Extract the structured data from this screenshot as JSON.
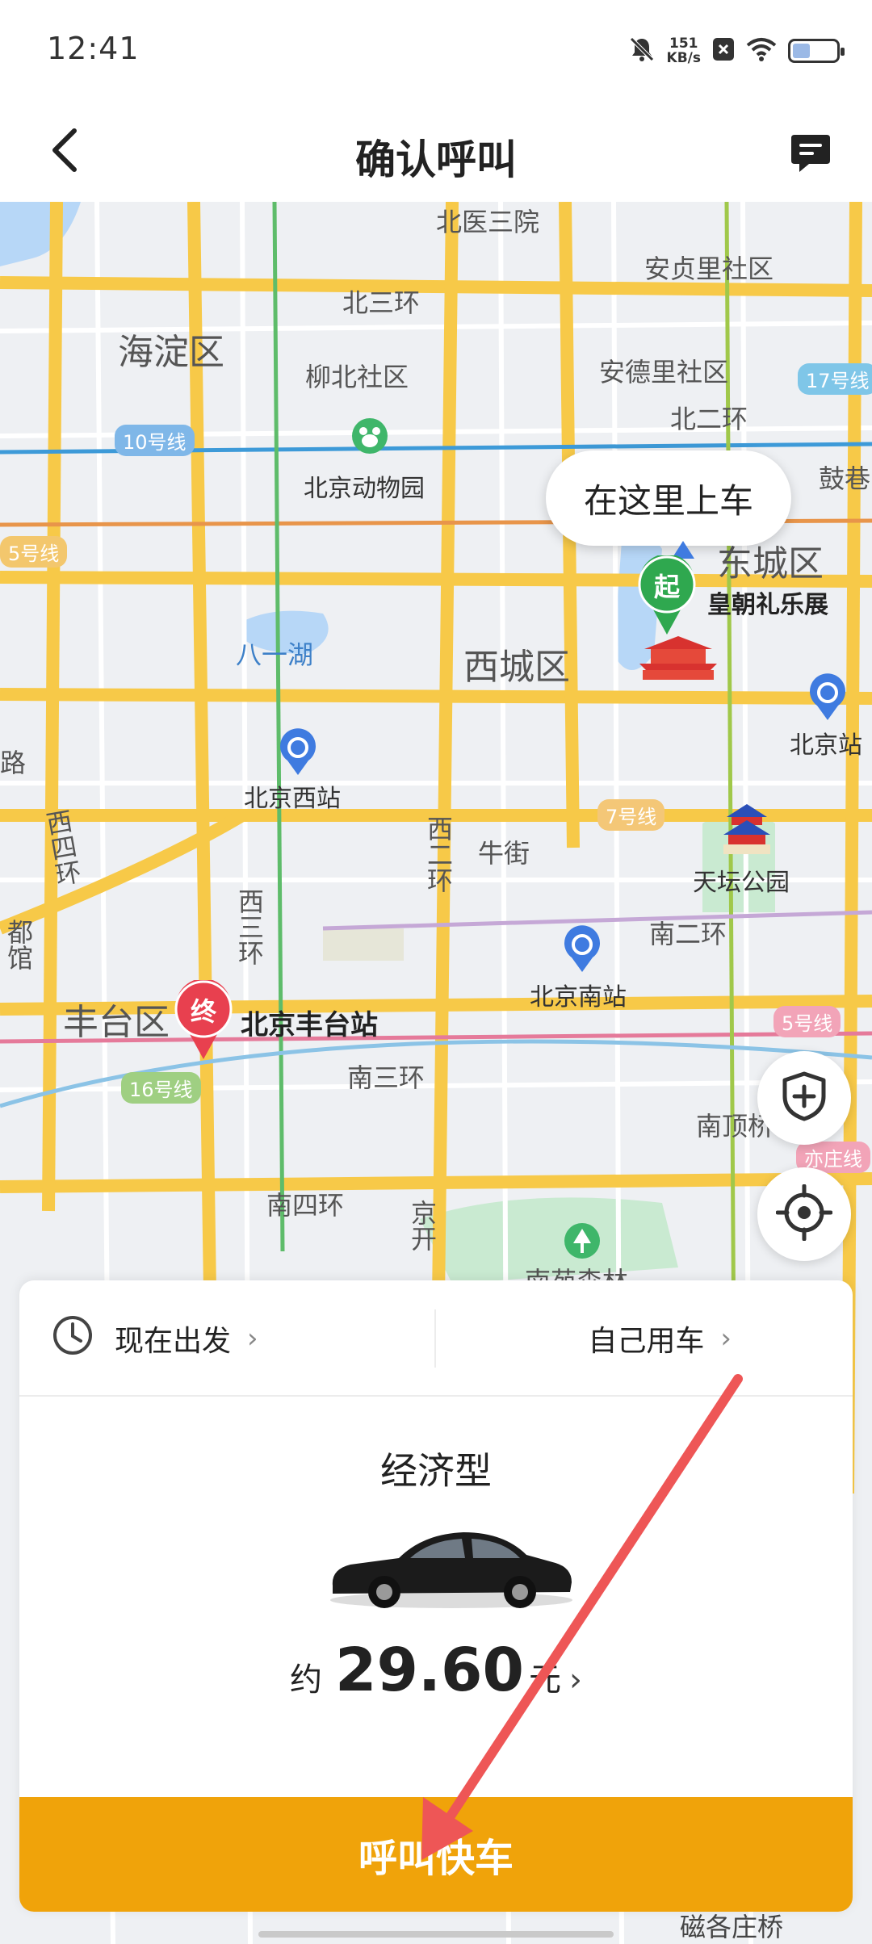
{
  "status_bar": {
    "time": "12:41",
    "net_speed_value": "151",
    "net_speed_unit": "KB/s",
    "battery_level_percent": 40,
    "icons": [
      "mute-icon",
      "close-box-icon",
      "wifi-icon",
      "battery-icon"
    ]
  },
  "header": {
    "title": "确认呼叫",
    "back_icon": "back-chevron-icon",
    "message_icon": "chat-icon"
  },
  "map": {
    "districts": [
      "海淀区",
      "东城区",
      "西城区",
      "丰台区"
    ],
    "labels": {
      "beiyisanyuan": "北医三院",
      "anzhenli": "安贞里社区",
      "beisanhuan": "北三环",
      "liubei": "柳北社区",
      "andeli": "安德里社区",
      "beierhuan": "北二环",
      "zoo": "北京动物园",
      "guxiang": "鼓巷",
      "bayihu": "八一湖",
      "huangchao": "皇朝礼乐展",
      "beijingxi": "北京西站",
      "beijingzhan": "北京站",
      "niujie": "牛街",
      "xierhuan": "西二环",
      "xisihuan": "西四环",
      "xisanhuan": "西三环",
      "tiantan": "天坛公园",
      "nanerhuan": "南二环",
      "beijingnan": "北京南站",
      "fengtaizhan": "北京丰台站",
      "nansanhuan": "南三环",
      "nandingqiao": "南顶桥",
      "nansihuan": "南四环",
      "jingkai": "京开",
      "nanyuan": "南苑森林",
      "lu": "路",
      "duguan": "都馆",
      "jiaochiqiao": "磁各庄桥"
    },
    "subway_lines": [
      "10号线",
      "17号线",
      "5号线",
      "7号线",
      "16号线",
      "亦庄线",
      "5号线"
    ],
    "pickup_bubble": "在这里上车",
    "start_pin": "起",
    "end_pin": "终",
    "colors": {
      "start_pin": "#2fa84f",
      "end_pin": "#e8404f",
      "ring_road": "#f7c948",
      "water": "#b7d7f7",
      "park": "#c9ead1"
    }
  },
  "sheet": {
    "depart_time": "现在出发",
    "rider": "自己用车",
    "car_type": "经济型",
    "price_prefix": "约",
    "price_value": "29.60",
    "price_unit": "元",
    "call_button": "呼叫快车",
    "accent_color": "#f0a30a"
  }
}
